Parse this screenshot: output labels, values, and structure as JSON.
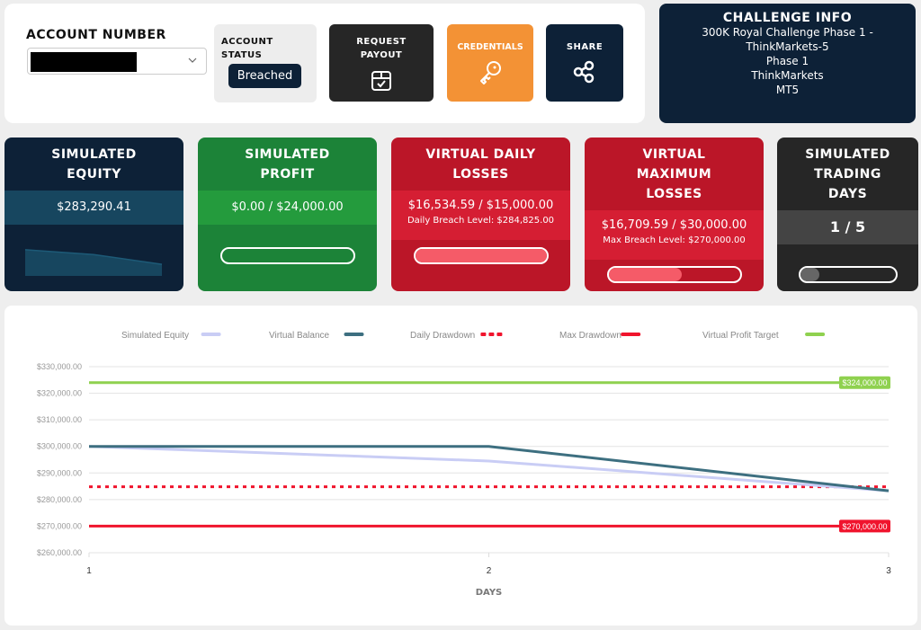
{
  "account": {
    "label": "Account Number",
    "selected_value": "",
    "status_label": "Account Status",
    "status": "Breached"
  },
  "actions": {
    "request_payout": "Request Payout",
    "credentials": "Credentials",
    "share": "Share",
    "icons": {
      "request_payout": "box-check-icon",
      "credentials": "key-icon",
      "share": "share-icon"
    }
  },
  "challenge_info": {
    "title": "Challenge Info",
    "lines": [
      "300K Royal Challenge Phase 1 -",
      "ThinkMarkets-5",
      "Phase 1",
      "ThinkMarkets",
      "MT5"
    ]
  },
  "cards": {
    "equity": {
      "title_1": "Simulated",
      "title_2": "Equity",
      "value": "$283,290.41",
      "spark": [
        300000,
        294500,
        283290.41
      ]
    },
    "profit": {
      "title_1": "Simulated",
      "title_2": "Profit",
      "value": "$0.00 / $24,000.00",
      "progress": 0
    },
    "daily": {
      "title_1": "Virtual Daily",
      "title_2": "Losses",
      "value": "$16,534.59 / $15,000.00",
      "sub": "Daily Breach Level: $284,825.00",
      "progress": 1.0
    },
    "max": {
      "title_1": "Virtual",
      "title_2": "Maximum",
      "title_3": "Losses",
      "value": "$16,709.59 / $30,000.00",
      "sub": "Max Breach Level: $270,000.00",
      "progress": 0.557
    },
    "days": {
      "title_1": "Simulated",
      "title_2": "Trading",
      "title_3": "Days",
      "value": "1 / 5",
      "progress": 0.2
    }
  },
  "colors": {
    "navy": "#0d2137",
    "green": "#1c8338",
    "red": "#bb1628",
    "orange": "#f39235",
    "dark": "#262626",
    "equity_line": "#c9cdf5",
    "balance_line": "#3d6f80",
    "daily_dd": "#f0142d",
    "max_dd": "#f0142d",
    "profit_target": "#8fd14f"
  },
  "chart_data": {
    "type": "line",
    "title": "",
    "xlabel": "Days",
    "ylabel": "",
    "x": [
      1,
      2,
      3
    ],
    "x_ticks": [
      "1",
      "2",
      "3"
    ],
    "ylim": [
      260000,
      330000
    ],
    "y_ticks": [
      "$260,000.00",
      "$270,000.00",
      "$280,000.00",
      "$290,000.00",
      "$300,000.00",
      "$310,000.00",
      "$320,000.00",
      "$330,000.00"
    ],
    "y_tick_values": [
      260000,
      270000,
      280000,
      290000,
      300000,
      310000,
      320000,
      330000
    ],
    "grid": true,
    "legend_position": "top",
    "series": [
      {
        "name": "Simulated Equity",
        "values": [
          300000,
          294500,
          283290.41
        ],
        "color": "#c9cdf5",
        "style": "solid"
      },
      {
        "name": "Virtual Balance",
        "values": [
          300000,
          300000,
          283290.41
        ],
        "color": "#3d6f80",
        "style": "solid"
      },
      {
        "name": "Daily Drawdown",
        "values": [
          284825,
          284825,
          284825
        ],
        "color": "#f0142d",
        "style": "dotted"
      },
      {
        "name": "Max Drawdown",
        "values": [
          270000,
          270000,
          270000
        ],
        "color": "#f0142d",
        "style": "solid",
        "annotation": "$270,000.00"
      },
      {
        "name": "Virtual Profit Target",
        "values": [
          324000,
          324000,
          324000
        ],
        "color": "#8fd14f",
        "style": "solid",
        "annotation": "$324,000.00"
      }
    ]
  }
}
